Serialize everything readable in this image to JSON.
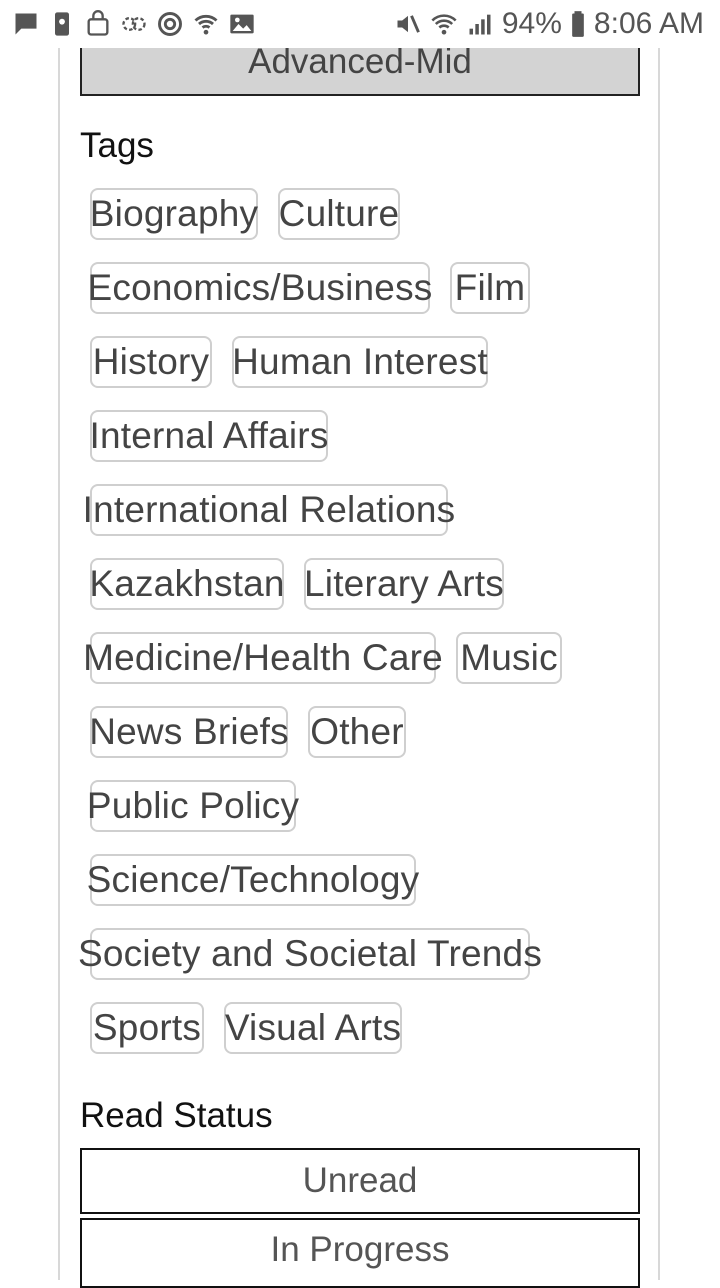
{
  "status_bar": {
    "left_icons": [
      "chat-icon",
      "phone-lock-icon",
      "bag-icon",
      "link-icon",
      "target-icon",
      "wifi-call-icon",
      "image-icon"
    ],
    "right_icons": [
      "mute-icon",
      "wifi-icon",
      "signal-icon",
      "battery-icon"
    ],
    "battery_percent": "94%",
    "time": "8:06 AM"
  },
  "level": {
    "label": "Advanced-Mid"
  },
  "tags": {
    "title": "Tags",
    "items": [
      "Biography",
      "Culture",
      "Economics/Business",
      "Film",
      "History",
      "Human Interest",
      "Internal Affairs",
      "International Relations",
      "Kazakhstan",
      "Literary Arts",
      "Medicine/Health Care",
      "Music",
      "News Briefs",
      "Other",
      "Public Policy",
      "Science/Technology",
      "Society and Societal Trends",
      "Sports",
      "Visual Arts"
    ]
  },
  "read_status": {
    "title": "Read Status",
    "options": [
      "Unread",
      "In Progress"
    ]
  }
}
